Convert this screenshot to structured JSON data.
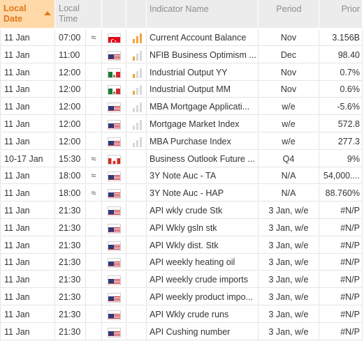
{
  "header": {
    "local_date_line1": "Local",
    "local_date_line2": "Date",
    "local_time_line1": "Local",
    "local_time_line2": "Time",
    "indicator_name": "Indicator Name",
    "period": "Period",
    "prior": "Prior"
  },
  "colors": {
    "header_bg": "#ececec",
    "sorted_header_bg": "#ffd9a8",
    "sorted_header_text": "#e0761b",
    "importance_active": "#f3a13b",
    "importance_inactive": "#d8d8d8",
    "row_border": "#e4e4e4"
  },
  "rows": [
    {
      "date": "11 Jan",
      "time": "07:00",
      "recurring": "≈",
      "country": "Turkey",
      "flag": "turkey-flag",
      "importance": 3,
      "name": "Current Account Balance",
      "period": "Nov",
      "prior": "3.156B"
    },
    {
      "date": "11 Jan",
      "time": "11:00",
      "recurring": "",
      "country": "United States",
      "flag": "us-flag",
      "importance": 1,
      "name": "NFIB Business Optimism ...",
      "period": "Dec",
      "prior": "98.40"
    },
    {
      "date": "11 Jan",
      "time": "12:00",
      "recurring": "",
      "country": "Mexico",
      "flag": "mexico-flag",
      "importance": 1,
      "name": "Industrial Output YY",
      "period": "Nov",
      "prior": "0.7%"
    },
    {
      "date": "11 Jan",
      "time": "12:00",
      "recurring": "",
      "country": "Mexico",
      "flag": "mexico-flag",
      "importance": 1,
      "name": "Industrial Output MM",
      "period": "Nov",
      "prior": "0.6%"
    },
    {
      "date": "11 Jan",
      "time": "12:00",
      "recurring": "",
      "country": "United States",
      "flag": "us-flag",
      "importance": 0,
      "name": "MBA Mortgage Applicati...",
      "period": "w/e",
      "prior": "-5.6%"
    },
    {
      "date": "11 Jan",
      "time": "12:00",
      "recurring": "",
      "country": "United States",
      "flag": "us-flag",
      "importance": 0,
      "name": "Mortgage Market Index",
      "period": "w/e",
      "prior": "572.8"
    },
    {
      "date": "11 Jan",
      "time": "12:00",
      "recurring": "",
      "country": "United States",
      "flag": "us-flag",
      "importance": 0,
      "name": "MBA Purchase Index",
      "period": "w/e",
      "prior": "277.3"
    },
    {
      "date": "10-17 Jan",
      "time": "15:30",
      "recurring": "≈",
      "country": "Canada",
      "flag": "canada-flag",
      "importance": null,
      "name": "Business Outlook Future ...",
      "period": "Q4",
      "prior": "9%"
    },
    {
      "date": "11 Jan",
      "time": "18:00",
      "recurring": "≈",
      "country": "United States",
      "flag": "us-flag",
      "importance": null,
      "name": "3Y Note Auc - TA",
      "period": "N/A",
      "prior": "54,000...."
    },
    {
      "date": "11 Jan",
      "time": "18:00",
      "recurring": "≈",
      "country": "United States",
      "flag": "us-flag",
      "importance": null,
      "name": "3Y Note Auc - HAP",
      "period": "N/A",
      "prior": "88.760%"
    },
    {
      "date": "11 Jan",
      "time": "21:30",
      "recurring": "",
      "country": "United States",
      "flag": "us-flag",
      "importance": null,
      "name": "API wkly crude Stk",
      "period": "3 Jan, w/e",
      "prior": "#N/P"
    },
    {
      "date": "11 Jan",
      "time": "21:30",
      "recurring": "",
      "country": "United States",
      "flag": "us-flag",
      "importance": null,
      "name": "API Wkly gsln stk",
      "period": "3 Jan, w/e",
      "prior": "#N/P"
    },
    {
      "date": "11 Jan",
      "time": "21:30",
      "recurring": "",
      "country": "United States",
      "flag": "us-flag",
      "importance": null,
      "name": "API Wkly dist. Stk",
      "period": "3 Jan, w/e",
      "prior": "#N/P"
    },
    {
      "date": "11 Jan",
      "time": "21:30",
      "recurring": "",
      "country": "United States",
      "flag": "us-flag",
      "importance": null,
      "name": "API weekly heating oil",
      "period": "3 Jan, w/e",
      "prior": "#N/P"
    },
    {
      "date": "11 Jan",
      "time": "21:30",
      "recurring": "",
      "country": "United States",
      "flag": "us-flag",
      "importance": null,
      "name": "API weekly crude imports",
      "period": "3 Jan, w/e",
      "prior": "#N/P"
    },
    {
      "date": "11 Jan",
      "time": "21:30",
      "recurring": "",
      "country": "United States",
      "flag": "us-flag",
      "importance": null,
      "name": "API weekly product impo...",
      "period": "3 Jan, w/e",
      "prior": "#N/P"
    },
    {
      "date": "11 Jan",
      "time": "21:30",
      "recurring": "",
      "country": "United States",
      "flag": "us-flag",
      "importance": null,
      "name": "API Wkly crude runs",
      "period": "3 Jan, w/e",
      "prior": "#N/P"
    },
    {
      "date": "11 Jan",
      "time": "21:30",
      "recurring": "",
      "country": "United States",
      "flag": "us-flag",
      "importance": null,
      "name": "API Cushing number",
      "period": "3 Jan, w/e",
      "prior": "#N/P"
    }
  ]
}
